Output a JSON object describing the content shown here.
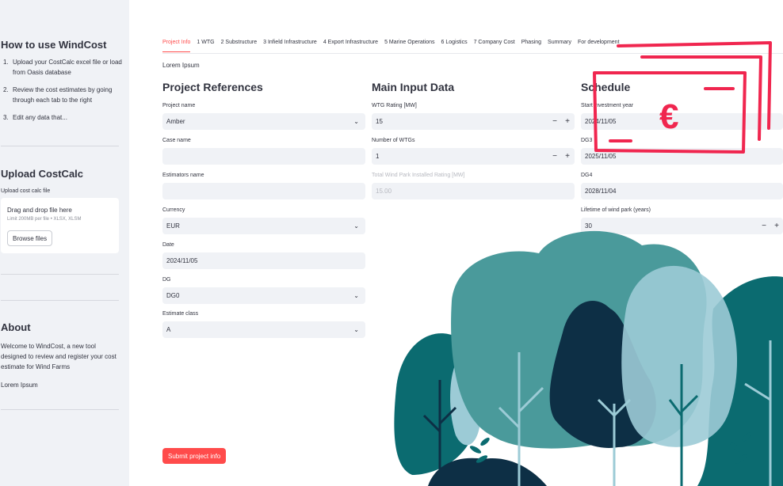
{
  "sidebar": {
    "how_title": "How to use WindCost",
    "steps": [
      {
        "num": "1.",
        "text": "Upload your CostCalc excel file or load from Oasis database"
      },
      {
        "num": "2.",
        "text": "Review the cost estimates by going through each tab to the right"
      },
      {
        "num": "3.",
        "text": "Edit any data that..."
      }
    ],
    "upload_title": "Upload CostCalc",
    "upload_label": "Upload cost calc file",
    "dropzone_text": "Drag and drop file here",
    "dropzone_limit": "Limit 200MB per file • XLSX, XLSM",
    "browse_label": "Browse files",
    "about_title": "About",
    "about_text": "Welcome to WindCost, a new tool designed to review and register your cost estimate for Wind Farms",
    "about_lorem": "Lorem Ipsum"
  },
  "tabs": [
    {
      "label": "Project Info",
      "active": true
    },
    {
      "label": "1 WTG"
    },
    {
      "label": "2 Substructure"
    },
    {
      "label": "3 Infield Infrastructure"
    },
    {
      "label": "4 Export Infrastructure"
    },
    {
      "label": "5 Marine Operations"
    },
    {
      "label": "6 Logistics"
    },
    {
      "label": "7 Company Cost"
    },
    {
      "label": "Phasing"
    },
    {
      "label": "Summary"
    },
    {
      "label": "For development"
    }
  ],
  "main_lorem": "Lorem Ipsum",
  "project_refs": {
    "title": "Project References",
    "project_name_label": "Project name",
    "project_name_value": "Amber",
    "case_name_label": "Case name",
    "case_name_value": "",
    "estimators_label": "Estimators name",
    "estimators_value": "",
    "currency_label": "Currency",
    "currency_value": "EUR",
    "date_label": "Date",
    "date_value": "2024/11/05",
    "dg_label": "DG",
    "dg_value": "DG0",
    "estimate_class_label": "Estimate class",
    "estimate_class_value": "A"
  },
  "main_input": {
    "title": "Main Input Data",
    "wtg_rating_label": "WTG Rating [MW]",
    "wtg_rating_value": "15",
    "num_wtgs_label": "Number of WTGs",
    "num_wtgs_value": "1",
    "total_rating_label": "Total Wind Park Installed Rating [MW]",
    "total_rating_value": "15.00"
  },
  "schedule": {
    "title": "Schedule",
    "start_label": "Start investment year",
    "start_value": "2024/11/05",
    "dg3_label": "DG3",
    "dg3_value": "2025/11/05",
    "dg4_label": "DG4",
    "dg4_value": "2028/11/04",
    "lifetime_label": "Lifetime of wind park (years)",
    "lifetime_value": "30"
  },
  "submit_label": "Submit project info",
  "stepper": {
    "minus": "−",
    "plus": "+"
  },
  "chevron": "⌄",
  "currency_symbol": "€",
  "colors": {
    "accent": "#ff4b4b",
    "sidebar_bg": "#f0f2f6",
    "input_bg": "#f0f2f6",
    "teal_dark": "#0b6b70",
    "teal_mid": "#4a9a9b",
    "teal_light": "#9ccbd6",
    "navy": "#0d2f45",
    "money_red": "#f0264f"
  }
}
